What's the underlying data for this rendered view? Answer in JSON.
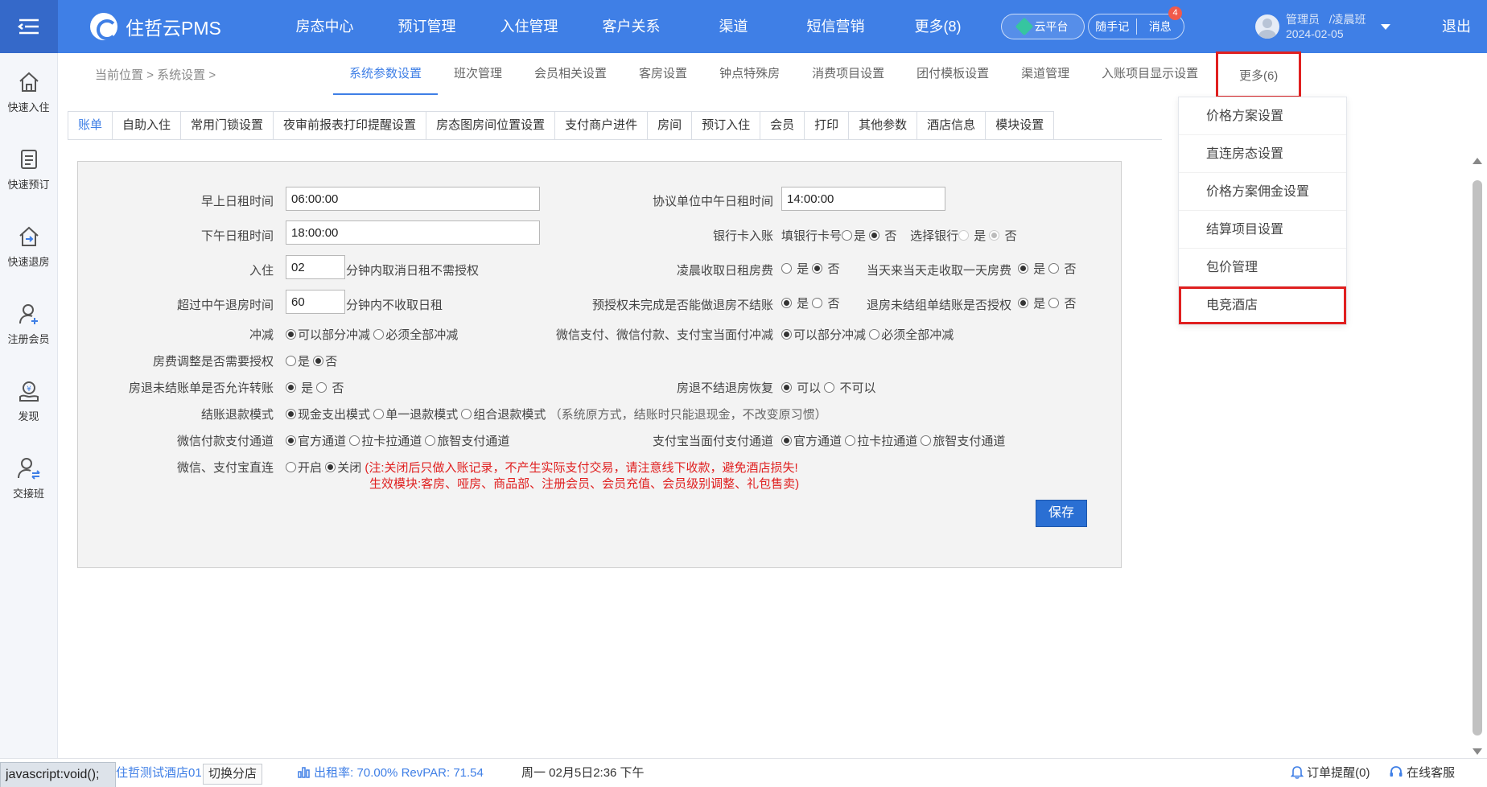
{
  "app": {
    "name": "住哲云PMS",
    "nav": [
      "房态中心",
      "预订管理",
      "入住管理",
      "客户关系",
      "渠道",
      "短信营销",
      "更多(8)"
    ],
    "cloud_label": "云平台",
    "notes_label": "随手记",
    "messages_label": "消息",
    "message_count": "4",
    "user_name": "管理员",
    "user_shift": "/凌晨班",
    "user_date": "2024-02-05",
    "logout": "退出"
  },
  "sidebar": [
    {
      "label": "快速入住",
      "icon": "home-icon"
    },
    {
      "label": "快速预订",
      "icon": "clipboard-icon"
    },
    {
      "label": "快速退房",
      "icon": "checkout-icon"
    },
    {
      "label": "注册会员",
      "icon": "add-user-icon"
    },
    {
      "label": "发现",
      "icon": "discover-icon"
    },
    {
      "label": "交接班",
      "icon": "shift-handover-icon"
    }
  ],
  "breadcrumb": {
    "prefix": "当前位置",
    "section": "系统设置",
    "sep": ">"
  },
  "subtabs": [
    "系统参数设置",
    "班次管理",
    "会员相关设置",
    "客房设置",
    "钟点特殊房",
    "消费项目设置",
    "团付模板设置",
    "渠道管理",
    "入账项目显示设置",
    "更多(6)"
  ],
  "innertabs": [
    "账单",
    "自助入住",
    "常用门锁设置",
    "夜审前报表打印提醒设置",
    "房态图房间位置设置",
    "支付商户进件",
    "房间",
    "预订入住",
    "会员",
    "打印",
    "其他参数",
    "酒店信息",
    "模块设置"
  ],
  "form": {
    "morning_rent_label": "早上日租时间",
    "morning_rent_value": "06:00:00",
    "afternoon_rent_label": "下午日租时间",
    "afternoon_rent_value": "18:00:00",
    "checkin_label": "入住",
    "checkin_value": "02",
    "checkin_suffix": "分钟内取消日租不需授权",
    "noon_checkout_label": "超过中午退房时间",
    "noon_checkout_value": "60",
    "noon_checkout_suffix": "分钟内不收取日租",
    "offset_label": "冲减",
    "offset_opt1": "可以部分冲减",
    "offset_opt2": "必须全部冲减",
    "room_rate_adjust_label": "房费调整是否需要授权",
    "yes": "是",
    "no": "否",
    "unsettled_transfer_label": "房退未结账单是否允许转账",
    "refund_mode_label": "结账退款模式",
    "refund_opt1": "现金支出模式",
    "refund_opt2": "单一退款模式",
    "refund_opt3": "组合退款模式",
    "refund_note": "（系统原方式，结账时只能退现金，不改变原习惯）",
    "wechat_channel_label": "微信付款支付通道",
    "channel_opt1": "官方通道",
    "channel_opt2": "拉卡拉通道",
    "channel_opt3": "旅智支付通道",
    "direct_label": "微信、支付宝直连",
    "direct_on": "开启",
    "direct_off": "关闭",
    "direct_note1": "(注:关闭后只做入账记录，不产生实际支付交易，请注意线下收款，避免酒店损失!",
    "direct_note2": "生效模块:客房、哑房、商品部、注册会员、会员充值、会员级别调整、礼包售卖)",
    "agreement_noon_label": "协议单位中午日租时间",
    "agreement_noon_value": "14:00:00",
    "bank_card_label": "银行卡入账",
    "bank_card_fill": "填银行卡号",
    "bank_select": "选择银行",
    "early_morning_label": "凌晨收取日租房费",
    "same_day_label": "当天来当天走收取一天房费",
    "preauth_label": "预授权未完成是否能做退房不结账",
    "group_unsettled_label": "退房未结组单结账是否授权",
    "wechat_counter_label": "微信支付、微信付款、支付宝当面付冲减",
    "unsettled_restore_label": "房退不结退房恢复",
    "can": "可以",
    "cannot": "不可以",
    "alipay_channel_label": "支付宝当面付支付通道",
    "save": "保存"
  },
  "dropdown": [
    "价格方案设置",
    "直连房态设置",
    "价格方案佣金设置",
    "结算项目设置",
    "包价管理",
    "电竞酒店"
  ],
  "status": {
    "tip": "javascript:void();",
    "hotel": "住哲测试酒店01",
    "switch_branch": "切换分店",
    "occupancy_label": "出租率:",
    "occupancy_value": "70.00%",
    "revpar_label": "RevPAR:",
    "revpar_value": "71.54",
    "datetime": "周一 02月5日2:36 下午",
    "order_alert": "订单提醒(0)",
    "support": "在线客服"
  },
  "colors": {
    "brand": "#3f7fe6",
    "highlight": "#e02020",
    "save": "#2a6fd3"
  }
}
